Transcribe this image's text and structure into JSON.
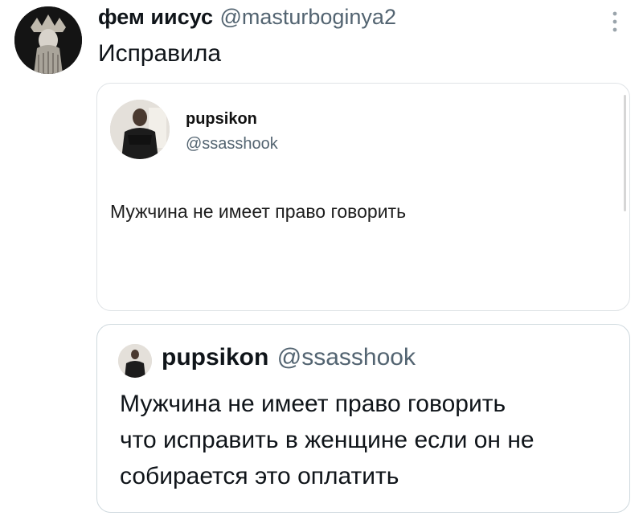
{
  "tweet": {
    "author_name": "фем иисус",
    "author_handle": "@masturboginya2",
    "text": "Исправила",
    "more_icon": "more-vertical-icon"
  },
  "quote_image": {
    "author_name": "pupsikon",
    "author_handle": "@ssasshook",
    "text": "Мужчина не имеет право говорить"
  },
  "quote_card": {
    "author_name": "pupsikon",
    "author_handle": "@ssasshook",
    "text_lines": [
      "Мужчина не имеет право говорить",
      "что исправить в женщине если он не",
      "собирается это оплатить"
    ]
  },
  "colors": {
    "text": "#0f1419",
    "secondary_text": "#536471",
    "border": "#cfd9de"
  }
}
